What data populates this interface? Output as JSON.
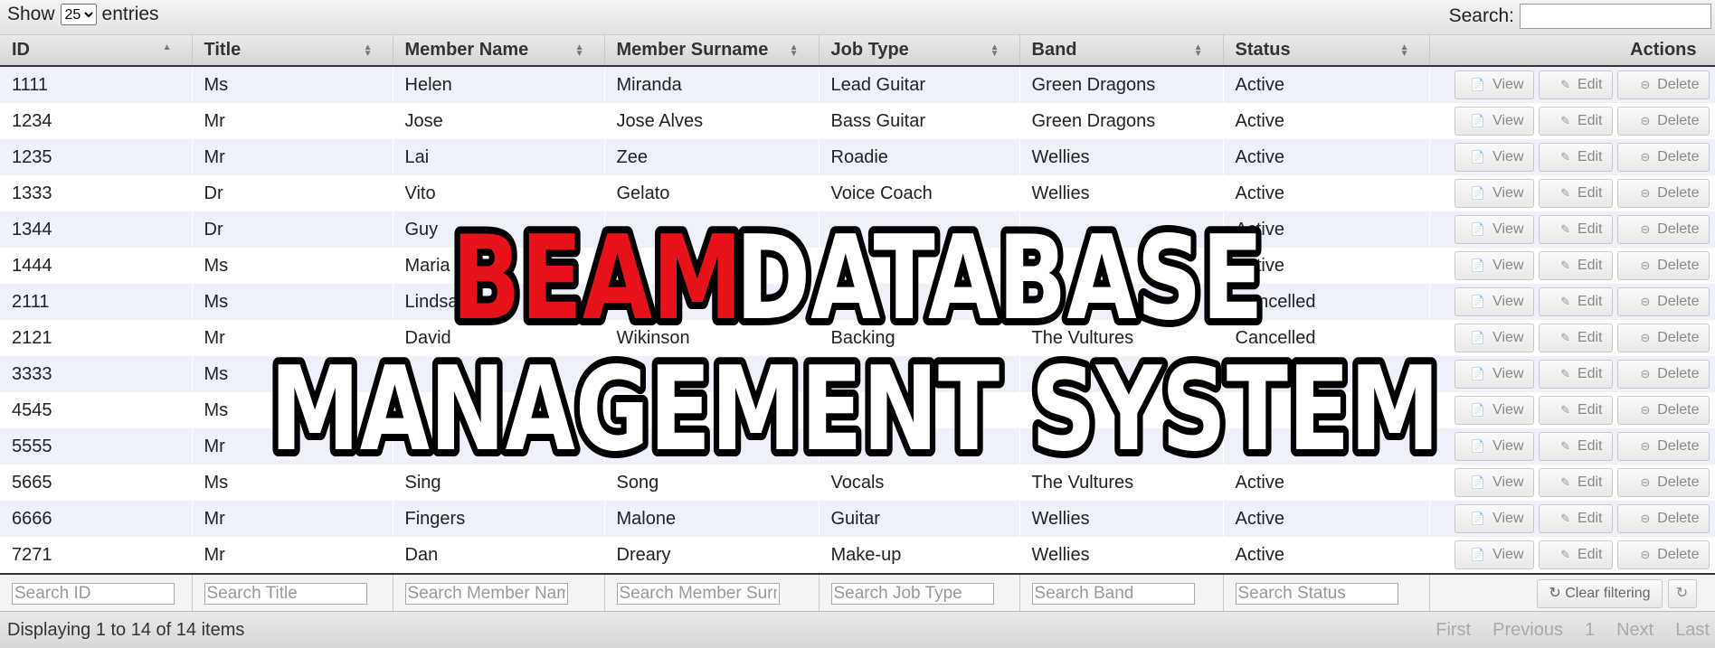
{
  "length_menu": {
    "show_label": "Show",
    "selected": "25",
    "entries_label": "entries"
  },
  "search": {
    "label": "Search:",
    "value": ""
  },
  "columns": [
    "ID",
    "Title",
    "Member Name",
    "Member Surname",
    "Job Type",
    "Band",
    "Status",
    "Actions"
  ],
  "actions": {
    "view": "View",
    "edit": "Edit",
    "delete": "Delete"
  },
  "rows": [
    [
      "1111",
      "Ms",
      "Helen",
      "Miranda",
      "Lead Guitar",
      "Green Dragons",
      "Active"
    ],
    [
      "1234",
      "Mr",
      "Jose",
      "Jose Alves",
      "Bass Guitar",
      "Green Dragons",
      "Active"
    ],
    [
      "1235",
      "Mr",
      "Lai",
      "Zee",
      "Roadie",
      "Wellies",
      "Active"
    ],
    [
      "1333",
      "Dr",
      "Vito",
      "Gelato",
      "Voice Coach",
      "Wellies",
      "Active"
    ],
    [
      "1344",
      "Dr",
      "Guy",
      "",
      "",
      "",
      "Active"
    ],
    [
      "1444",
      "Ms",
      "Maria",
      "",
      "",
      "",
      "Active"
    ],
    [
      "2111",
      "Ms",
      "Lindsay",
      "",
      "",
      "",
      "Cancelled"
    ],
    [
      "2121",
      "Mr",
      "David",
      "Wikinson",
      "Backing",
      "The Vultures",
      "Cancelled"
    ],
    [
      "3333",
      "Ms",
      "",
      "",
      "",
      "",
      ""
    ],
    [
      "4545",
      "Ms",
      "",
      "",
      "",
      "",
      ""
    ],
    [
      "5555",
      "Mr",
      "",
      "",
      "",
      "",
      ""
    ],
    [
      "5665",
      "Ms",
      "Sing",
      "Song",
      "Vocals",
      "The Vultures",
      "Active"
    ],
    [
      "6666",
      "Mr",
      "Fingers",
      "Malone",
      "Guitar",
      "Wellies",
      "Active"
    ],
    [
      "7271",
      "Mr",
      "Dan",
      "Dreary",
      "Make-up",
      "Wellies",
      "Active"
    ]
  ],
  "filters": [
    "Search ID",
    "Search Title",
    "Search Member Name",
    "Search Member Surna",
    "Search Job Type",
    "Search Band",
    "Search Status"
  ],
  "clear_filtering": "Clear filtering",
  "info": "Displaying 1 to 14 of 14 items",
  "pager": {
    "first": "First",
    "previous": "Previous",
    "page": "1",
    "next": "Next",
    "last": "Last"
  },
  "banner": {
    "word1": "BEAM",
    "word2": "DATABASE",
    "line2": "MANAGEMENT SYSTEM"
  },
  "colors": {
    "banner_red": "#e8121b",
    "row_stripe": "#eef0fa"
  }
}
